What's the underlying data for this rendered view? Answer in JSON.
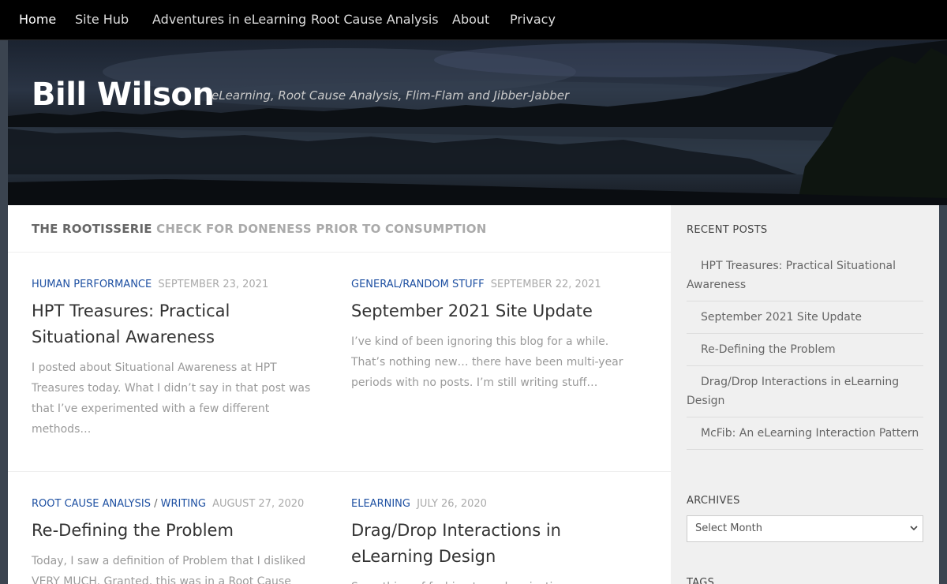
{
  "nav": {
    "items": [
      "Home",
      "Site Hub",
      "Adventures in eLearning",
      "Root Cause Analysis",
      "About",
      "Privacy"
    ]
  },
  "header": {
    "site_title": "Bill Wilson",
    "tagline": "eLearning, Root Cause Analysis, Flim-Flam and Jibber-Jabber"
  },
  "main": {
    "heading_main": "THE ROOTISSERIE",
    "heading_sub": "CHECK FOR DONENESS PRIOR TO CONSUMPTION",
    "posts": [
      {
        "categories": [
          "HUMAN PERFORMANCE"
        ],
        "date": "SEPTEMBER 23, 2021",
        "title": "HPT Treasures: Practical Situational Awareness",
        "excerpt": "I posted about Situational Awareness at HPT Treasures today. What I didn’t say in that post was that I’ve experimented with a few different methods…"
      },
      {
        "categories": [
          "GENERAL/RANDOM STUFF"
        ],
        "date": "SEPTEMBER 22, 2021",
        "title": "September 2021 Site Update",
        "excerpt": "I’ve kind of been ignoring this blog for a while. That’s nothing new… there have been multi-year periods with no posts. I’m still writing stuff…"
      },
      {
        "categories": [
          "ROOT CAUSE ANALYSIS",
          "WRITING"
        ],
        "category_separator": "/",
        "date": "AUGUST 27, 2020",
        "title": "Re-Defining the Problem",
        "excerpt": "Today, I saw a definition of Problem that I disliked VERY MUCH. Granted, this was in a Root Cause"
      },
      {
        "categories": [
          "ELEARNING"
        ],
        "date": "JULY 26, 2020",
        "title": "Drag/Drop Interactions in eLearning Design",
        "excerpt": "Something of fashion to and projection"
      }
    ]
  },
  "sidebar": {
    "recent_title": "RECENT POSTS",
    "recent_posts": [
      "HPT Treasures: Practical Situational Awareness",
      "September 2021 Site Update",
      "Re-Defining the Problem",
      "Drag/Drop Interactions in eLearning Design",
      "McFib: An eLearning Interaction Pattern"
    ],
    "archives_title": "ARCHIVES",
    "archives_select": "Select Month",
    "tags_title": "TAGS"
  },
  "colors": {
    "nav_bg": "#000000",
    "link_blue": "#1e50a2",
    "page_bg": "#3b4450",
    "sidebar_bg": "#f0f0f0"
  }
}
